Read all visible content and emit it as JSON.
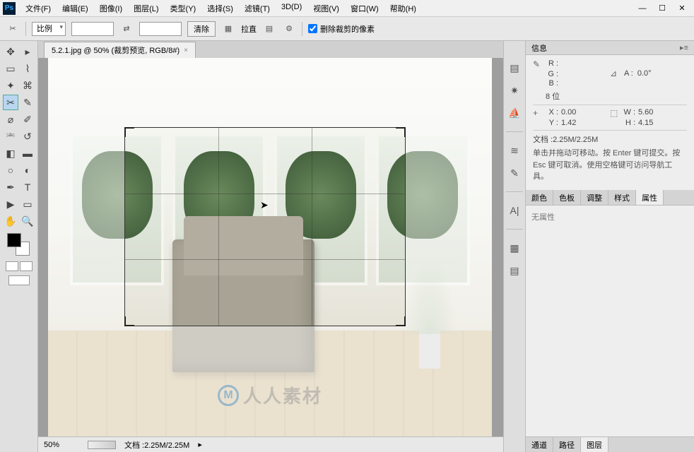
{
  "app": {
    "logo": "Ps"
  },
  "menu": {
    "file": "文件(F)",
    "edit": "编辑(E)",
    "image": "图像(I)",
    "layer": "图层(L)",
    "type": "类型(Y)",
    "select": "选择(S)",
    "filter": "滤镜(T)",
    "threed": "3D(D)",
    "view": "视图(V)",
    "window": "窗口(W)",
    "help": "帮助(H)"
  },
  "options": {
    "ratio_label": "比例",
    "clear": "清除",
    "straighten": "拉直",
    "delete_cropped": "删除裁剪的像素"
  },
  "doc": {
    "tab_title": "5.2.1.jpg @ 50% (裁剪预览, RGB/8#)",
    "zoom": "50%",
    "status_doc": "文档 :2.25M/2.25M"
  },
  "watermark": {
    "logo": "M",
    "text": "人人素材"
  },
  "info_panel": {
    "title": "信息",
    "r": "R :",
    "g": "G :",
    "b": "B :",
    "angle_sym": "⊿",
    "angle_label": "A :",
    "angle_val": "0.0°",
    "bits": "8 位",
    "x_label": "X :",
    "x_val": "0.00",
    "y_label": "Y :",
    "y_val": "1.42",
    "w_label": "W :",
    "w_val": "5.60",
    "h_label": "H :",
    "h_val": "4.15",
    "doc_size": "文档 :2.25M/2.25M",
    "help": "单击并拖动可移动。按 Enter 键可提交。按 Esc 键可取消。使用空格键可访问导航工具。"
  },
  "mid_tabs": {
    "color": "颜色",
    "swatches": "色板",
    "adjustments": "调整",
    "styles": "样式",
    "properties": "属性"
  },
  "properties": {
    "empty": "无属性"
  },
  "bottom_tabs": {
    "channels": "通道",
    "paths": "路径",
    "layers": "图层"
  }
}
